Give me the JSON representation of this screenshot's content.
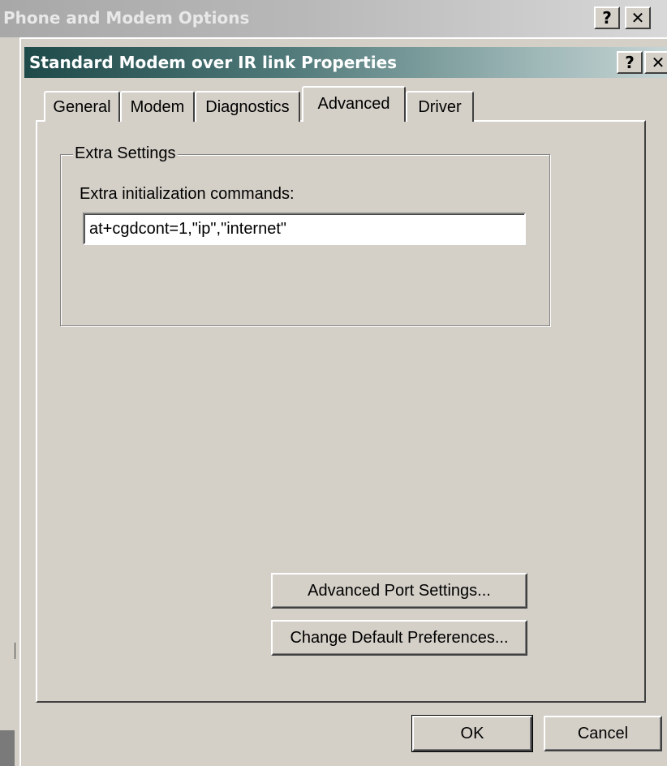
{
  "outer_window": {
    "title": "Phone and Modem Options",
    "help_button": "?",
    "close_button": "✕"
  },
  "dialog": {
    "title": "Standard Modem over IR link Properties",
    "help_button": "?",
    "close_button": "✕"
  },
  "tabs": [
    {
      "label": "General",
      "active": false
    },
    {
      "label": "Modem",
      "active": false
    },
    {
      "label": "Diagnostics",
      "active": false
    },
    {
      "label": "Advanced",
      "active": true
    },
    {
      "label": "Driver",
      "active": false
    }
  ],
  "extra_settings": {
    "group_label": "Extra Settings",
    "field_label": "Extra initialization commands:",
    "field_value": "at+cgdcont=1,\"ip\",\"internet\""
  },
  "buttons": {
    "advanced_port_settings": "Advanced Port Settings...",
    "change_default_preferences": "Change Default Preferences...",
    "ok": "OK",
    "cancel": "Cancel"
  },
  "colors": {
    "dialog_face": "#d4d0c8",
    "active_title_start": "#1f4a4a",
    "inactive_title": "#a8a8a8"
  }
}
